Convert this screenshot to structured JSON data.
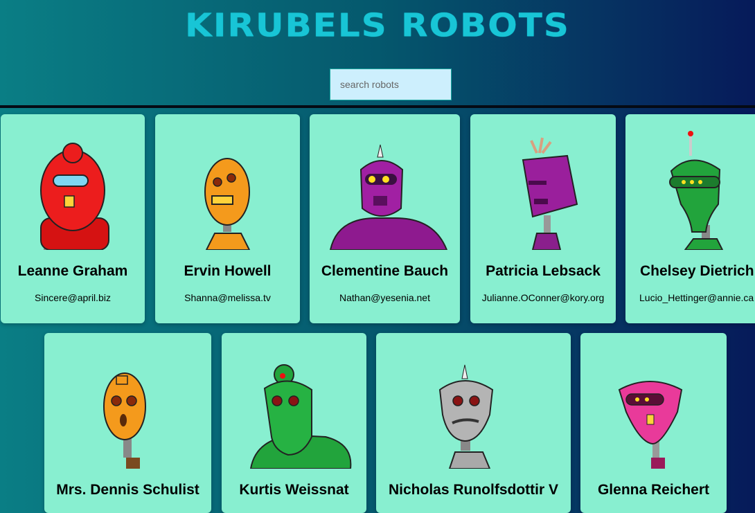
{
  "header": {
    "title": "KIRUBELS ROBOTS"
  },
  "search": {
    "placeholder": "search robots"
  },
  "robots": [
    {
      "name": "Leanne Graham",
      "email": "Sincere@april.biz",
      "color": "#e81818"
    },
    {
      "name": "Ervin Howell",
      "email": "Shanna@melissa.tv",
      "color": "#f49a1c"
    },
    {
      "name": "Clementine Bauch",
      "email": "Nathan@yesenia.net",
      "color": "#8e1a8f"
    },
    {
      "name": "Patricia Lebsack",
      "email": "Julianne.OConner@kory.org",
      "color": "#8a1f8c"
    },
    {
      "name": "Chelsey Dietrich",
      "email": "Lucio_Hettinger@annie.ca",
      "color": "#22a43c"
    },
    {
      "name": "Mrs. Dennis Schulist",
      "email": "",
      "color": "#f49a1c"
    },
    {
      "name": "Kurtis Weissnat",
      "email": "",
      "color": "#22a43c"
    },
    {
      "name": "Nicholas Runolfsdottir V",
      "email": "",
      "color": "#a9a9a9"
    },
    {
      "name": "Glenna Reichert",
      "email": "",
      "color": "#e93a9a"
    }
  ]
}
